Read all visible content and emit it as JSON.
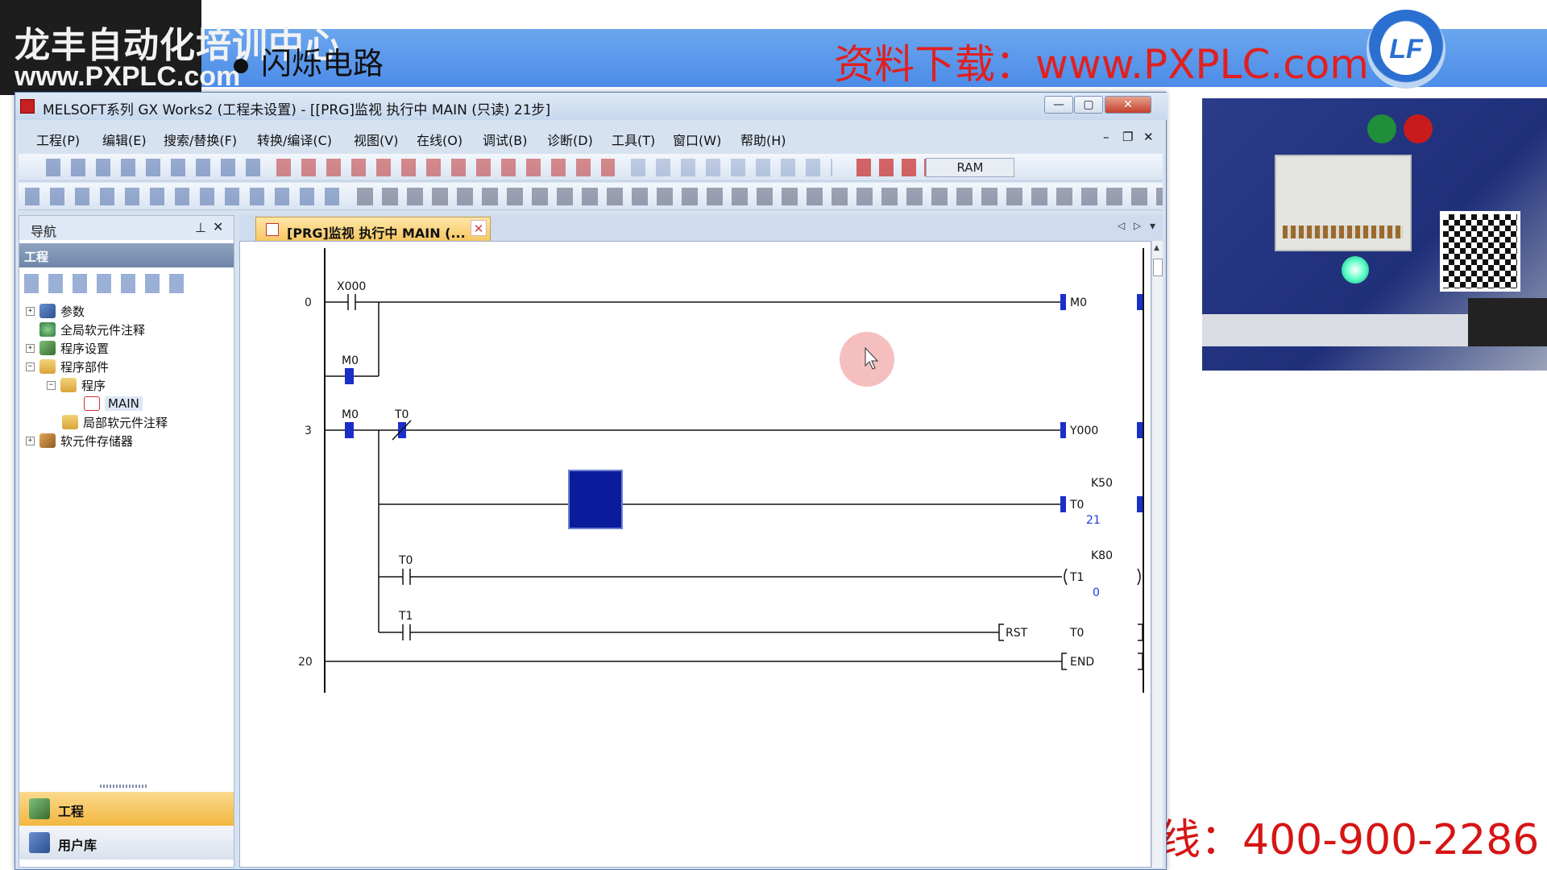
{
  "banner": {
    "logo_line1": "龙丰自动化培训中心",
    "logo_line2": "www.PXPLC.com",
    "topic": "闪烁电路",
    "download": "资料下载：www.PXPLC.com",
    "lf_logo": "LF",
    "phone": "线：400-900-2286"
  },
  "window": {
    "title": "MELSOFT系列 GX Works2 (工程未设置) - [[PRG]监视 执行中 MAIN (只读) 21步]",
    "buttons": {
      "minimize": "—",
      "maximize": "▢",
      "close": "✕"
    },
    "mdi": {
      "minimize": "–",
      "restore": "❐",
      "close": "✕"
    }
  },
  "menu": [
    "工程(P)",
    "编辑(E)",
    "搜索/替换(F)",
    "转换/编译(C)",
    "视图(V)",
    "在线(O)",
    "调试(B)",
    "诊断(D)",
    "工具(T)",
    "窗口(W)",
    "帮助(H)"
  ],
  "toolbar": {
    "ram": "RAM"
  },
  "nav": {
    "title": "导航",
    "pin": "⊥",
    "close": "✕",
    "section": "工程",
    "tree": [
      {
        "label": "参数",
        "exp": "+"
      },
      {
        "label": "全局软元件注释",
        "exp": ""
      },
      {
        "label": "程序设置",
        "exp": "+"
      },
      {
        "label": "程序部件",
        "exp": "−"
      },
      {
        "label": "程序",
        "exp": "−"
      },
      {
        "label": "MAIN",
        "exp": ""
      },
      {
        "label": "局部软元件注释",
        "exp": ""
      },
      {
        "label": "软元件存储器",
        "exp": "+"
      }
    ],
    "footer": [
      {
        "label": "工程"
      },
      {
        "label": "用户库"
      }
    ]
  },
  "tab": {
    "label": "[PRG]监视 执行中 MAIN (...",
    "close": "✕",
    "prev": "◁",
    "next": "▷",
    "menu": "▾"
  },
  "ladder": {
    "steps": [
      "0",
      "3",
      "20"
    ],
    "devices": {
      "x000": "X000",
      "m0_a": "M0",
      "m0_b": "M0",
      "t0_a": "T0",
      "t0_b": "T0",
      "t1": "T1",
      "coil_m0": "M0",
      "coil_y000": "Y000",
      "coil_t0": "T0",
      "coil_t1": "T1",
      "k50": "K50",
      "k80": "K80",
      "t0_value": "21",
      "t1_value": "0",
      "rst": "RST",
      "rst_target": "T0",
      "end": "END"
    }
  },
  "colors": {
    "active_contact": "#1a2fc8",
    "monitor_value": "#1a3cd6",
    "cursor_highlight": "#f3a9a9",
    "selection_box": "#0a1c9c"
  }
}
